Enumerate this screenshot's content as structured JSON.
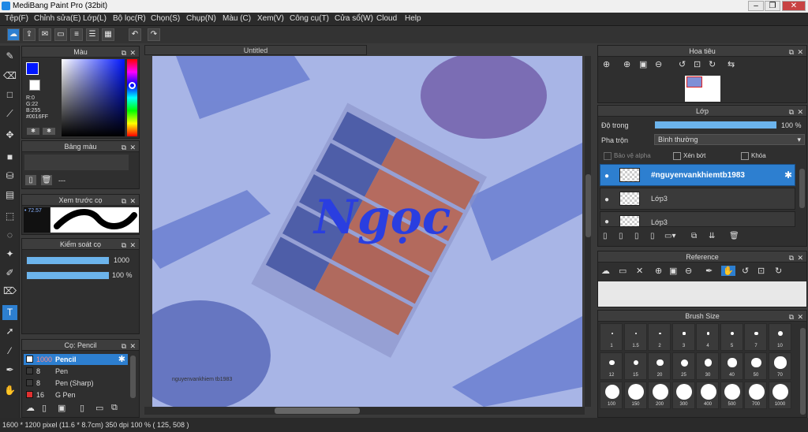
{
  "app": {
    "title": "MediBang Paint Pro (32bit)"
  },
  "menu": [
    "Tệp(F)",
    "Chỉnh sửa(E)",
    "Lớp(L)",
    "Bộ lọc(R)",
    "Chọn(S)",
    "Chụp(N)",
    "Màu (C)",
    "Xem(V)",
    "Công cụ(T)",
    "Cửa sổ(W)",
    "Cloud",
    "Help"
  ],
  "panels": {
    "color": {
      "title": "Màu",
      "r": "R:0",
      "g": "G:22",
      "b": "B:255",
      "hex": "#0016FF",
      "primary": "#0016FF"
    },
    "palette": {
      "title": "Bảng màu",
      "empty": "---"
    },
    "brush_preview": {
      "title": "Xem trước cọ",
      "size": "72.57"
    },
    "brush_control": {
      "title": "Kiểm soát cọ",
      "size_value": "1000",
      "opacity_value": "100 %"
    },
    "brushes": {
      "title": "Cọ: Pencil",
      "items": [
        {
          "size": "1000",
          "name": "Pencil",
          "color": "#ffffff"
        },
        {
          "size": "8",
          "name": "Pen",
          "color": "#3a3a3a"
        },
        {
          "size": "8",
          "name": "Pen (Sharp)",
          "color": "#3a3a3a"
        },
        {
          "size": "16",
          "name": "G Pen",
          "color": "#e03030"
        }
      ]
    }
  },
  "document": {
    "tab": "Untitled",
    "overlay_text": "Ngọc",
    "watermark": "nguyenvankhiem tb1983"
  },
  "right": {
    "navigator": {
      "title": "Hoa tiêu"
    },
    "layer": {
      "title": "Lớp",
      "opacity_label": "Độ trong",
      "opacity_value": "100 %",
      "blend_label": "Pha trộn",
      "blend_value": "Bình thường",
      "protect_alpha": "Bảo vệ alpha",
      "clipping": "Xén bớt",
      "lock": "Khóa",
      "layers": [
        "#nguyenvankhiemtb1983",
        "Lớp3",
        "Lớp3"
      ]
    },
    "reference": {
      "title": "Reference"
    },
    "brush_size": {
      "title": "Brush Size",
      "sizes": [
        "1",
        "1.5",
        "2",
        "3",
        "4",
        "5",
        "7",
        "10",
        "12",
        "15",
        "20",
        "25",
        "30",
        "40",
        "50",
        "70",
        "100",
        "150",
        "200",
        "300",
        "400",
        "500",
        "700",
        "1000"
      ]
    }
  },
  "status": {
    "text": "1600 * 1200 pixel   (11.6 * 8.7cm)   350 dpi   100 %   ( 125, 508 )"
  }
}
